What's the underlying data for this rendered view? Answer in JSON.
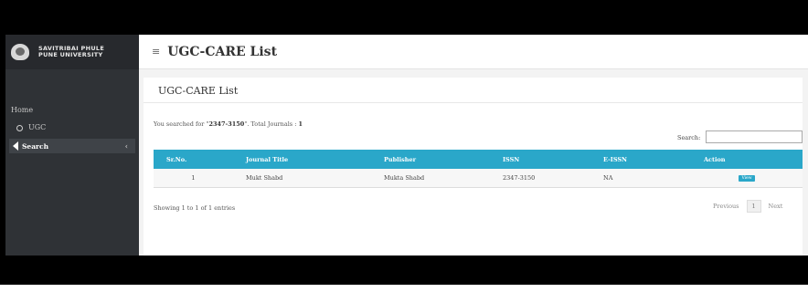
{
  "brand": {
    "line1": "SAVITRIBAI PHULE",
    "line2": "PUNE UNIVERSITY"
  },
  "sidebar": {
    "items": [
      {
        "label": "Home"
      },
      {
        "label": "UGC"
      },
      {
        "label": "Search"
      }
    ]
  },
  "header": {
    "title": "UGC-CARE List"
  },
  "panel": {
    "title": "UGC-CARE List",
    "search_prefix": "You searched for \"",
    "search_query": "2347-3150",
    "search_suffix": "\". Total Journals : ",
    "total": "1",
    "search_label": "Search:",
    "search_value": ""
  },
  "table": {
    "columns": [
      "Sr.No.",
      "Journal Title",
      "Publisher",
      "ISSN",
      "E-ISSN",
      "Action"
    ],
    "rows": [
      {
        "sr": "1",
        "title": "Mukt Shabd",
        "publisher": "Mukta Shabd",
        "issn": "2347-3150",
        "eissn": "NA",
        "action": "View"
      }
    ]
  },
  "footer": {
    "entries": "Showing 1 to 1 of 1 entries",
    "prev": "Previous",
    "page": "1",
    "next": "Next"
  }
}
